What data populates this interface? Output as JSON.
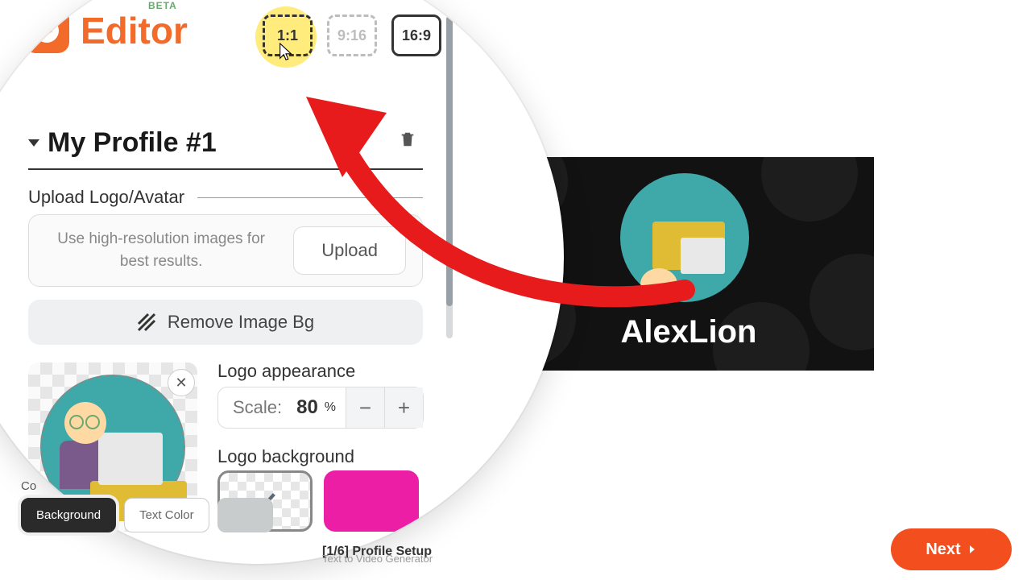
{
  "brand": {
    "name": "Editor",
    "badge": "BETA"
  },
  "ratios": {
    "r1": "1:1",
    "r2": "9:16",
    "r3": "16:9"
  },
  "section": {
    "title": "My Profile #1"
  },
  "upload": {
    "label": "Upload Logo/Avatar",
    "hint": "Use high-resolution images for best results.",
    "button": "Upload"
  },
  "remove_bg": "Remove Image Bg",
  "appearance": {
    "label": "Logo appearance",
    "scale_label": "Scale:",
    "scale_value": "80",
    "scale_unit": "%"
  },
  "logo_bg": {
    "label": "Logo background",
    "color2": "#ec1ea6"
  },
  "chips": {
    "prefix": "Co",
    "bg": "Background",
    "text": "Text Color",
    "third": ""
  },
  "preview": {
    "name": "AlexLion"
  },
  "footer": {
    "step_prefix": "[",
    "step_cur": "1",
    "step_sep": "/",
    "step_total": "6",
    "step_suffix": "]",
    "step_title": "Profile Setup",
    "subtitle": "Text to Video Generator",
    "next": "Next"
  }
}
